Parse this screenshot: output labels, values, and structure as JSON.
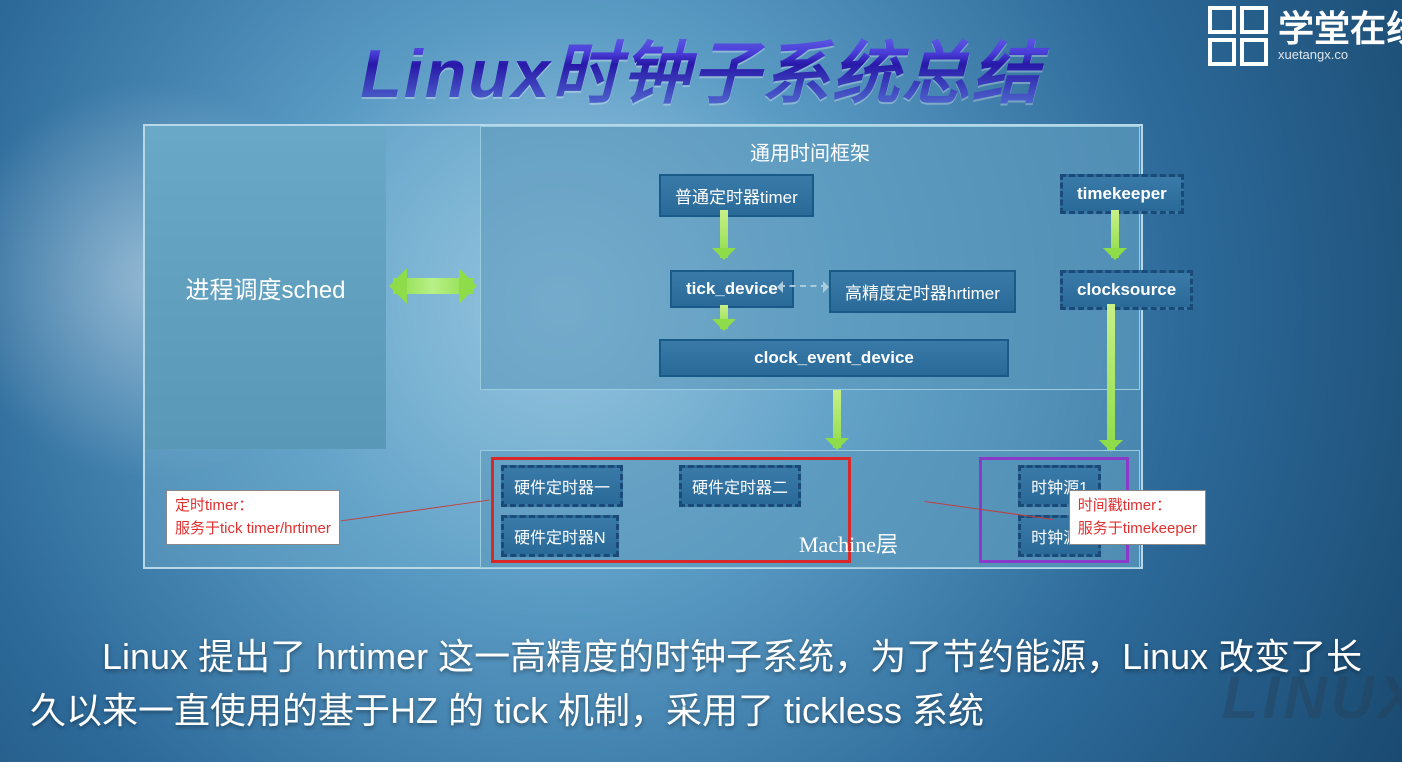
{
  "title": "Linux时钟子系统总结",
  "logo": {
    "name": "学堂在线",
    "sub": "xuetangx.co"
  },
  "diagram": {
    "sched": "进程调度sched",
    "common_frame_title": "通用时间框架",
    "nodes": {
      "timer": "普通定时器timer",
      "tick_device": "tick_device",
      "hrtimer": "高精度定时器hrtimer",
      "timekeeper": "timekeeper",
      "clocksource": "clocksource",
      "clock_event_device": "clock_event_device"
    },
    "machine": {
      "title": "Machine层",
      "hw1": "硬件定时器一",
      "hw2": "硬件定时器二",
      "hwN": "硬件定时器N",
      "cs1": "时钟源1",
      "cs2": "时钟源2"
    },
    "note_left": {
      "l1": "定时timer：",
      "l2": "服务于tick timer/hrtimer"
    },
    "note_right": {
      "l1": "时间戳timer：",
      "l2": "服务于timekeeper"
    }
  },
  "description": "Linux 提出了 hrtimer 这一高精度的时钟子系统，为了节约能源，Linux 改变了长久以来一直使用的基于HZ 的 tick 机制，采用了 tickless 系统",
  "watermark": "LINUX"
}
